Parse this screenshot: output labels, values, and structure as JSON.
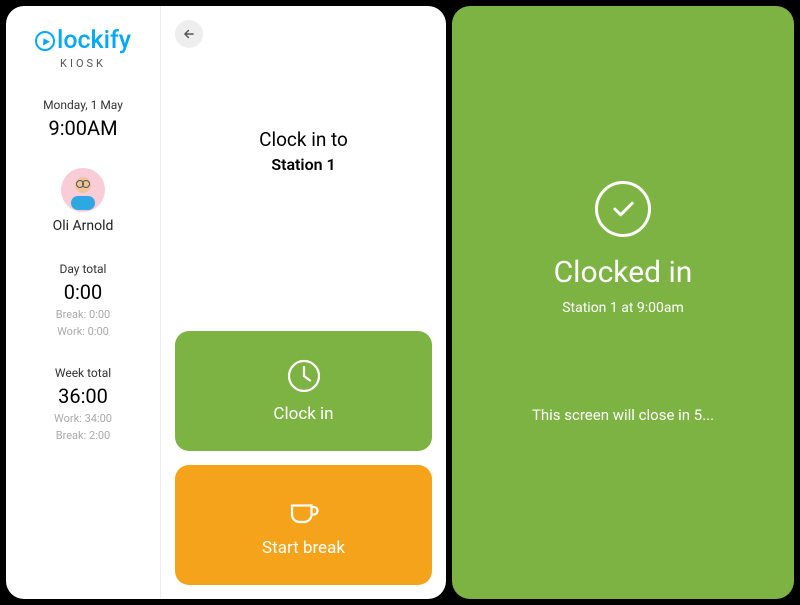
{
  "brand": {
    "name": "lockify",
    "sub": "KIOSK"
  },
  "sidebar": {
    "date": "Monday, 1 May",
    "time": "9:00AM",
    "userName": "Oli Arnold",
    "day": {
      "label": "Day total",
      "value": "0:00",
      "break": "Break: 0:00",
      "work": "Work: 0:00"
    },
    "week": {
      "label": "Week total",
      "value": "36:00",
      "work": "Work: 34:00",
      "break": "Break: 2:00"
    }
  },
  "main": {
    "heading": "Clock in to",
    "station": "Station 1",
    "clockInLabel": "Clock in",
    "breakLabel": "Start break"
  },
  "confirm": {
    "title": "Clocked in",
    "detail": "Station 1 at 9:00am",
    "countdown": "This screen will close in 5..."
  }
}
